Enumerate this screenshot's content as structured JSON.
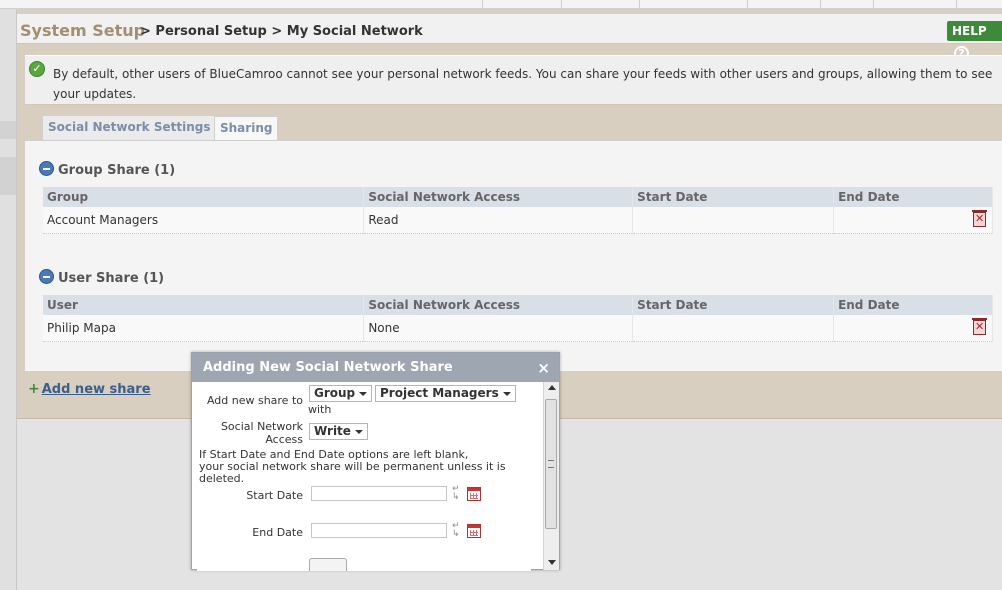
{
  "header": {
    "title": "System Setup",
    "breadcrumbs": "> Personal Setup > My Social Network",
    "help_label": "HELP",
    "help_symbol": "?"
  },
  "notice": {
    "text": "By default, other users of BlueCamroo cannot see your personal network feeds. You can share your feeds with other users and groups, allowing them to see your updates."
  },
  "tabs": [
    {
      "label": "Social Network Settings",
      "active": false
    },
    {
      "label": "Sharing",
      "active": true
    }
  ],
  "group_share": {
    "title": "Group Share (1)",
    "columns": [
      "Group",
      "Social Network Access",
      "Start Date",
      "End Date"
    ],
    "rows": [
      {
        "name": "Account Managers",
        "access": "Read",
        "start": "",
        "end": ""
      }
    ]
  },
  "user_share": {
    "title": "User Share (1)",
    "columns": [
      "User",
      "Social Network Access",
      "Start Date",
      "End Date"
    ],
    "rows": [
      {
        "name": "Philip Mapa",
        "access": "None",
        "start": "",
        "end": ""
      }
    ]
  },
  "add_new_share": {
    "plus": "+",
    "label": "Add new share"
  },
  "dialog": {
    "title": "Adding New Social Network Share",
    "close_symbol": "×",
    "add_to_label": "Add new share to",
    "with_label": "with",
    "share_type": "Group",
    "share_target": "Project Managers",
    "access_label_line1": "Social Network",
    "access_label_line2": "Access",
    "access_value": "Write",
    "note_line1": "If Start Date and End Date options are left blank,",
    "note_line2": "your social network share will be permanent unless it is deleted.",
    "start_date_label": "Start Date",
    "end_date_label": "End Date",
    "start_date_value": "",
    "end_date_value": ""
  }
}
